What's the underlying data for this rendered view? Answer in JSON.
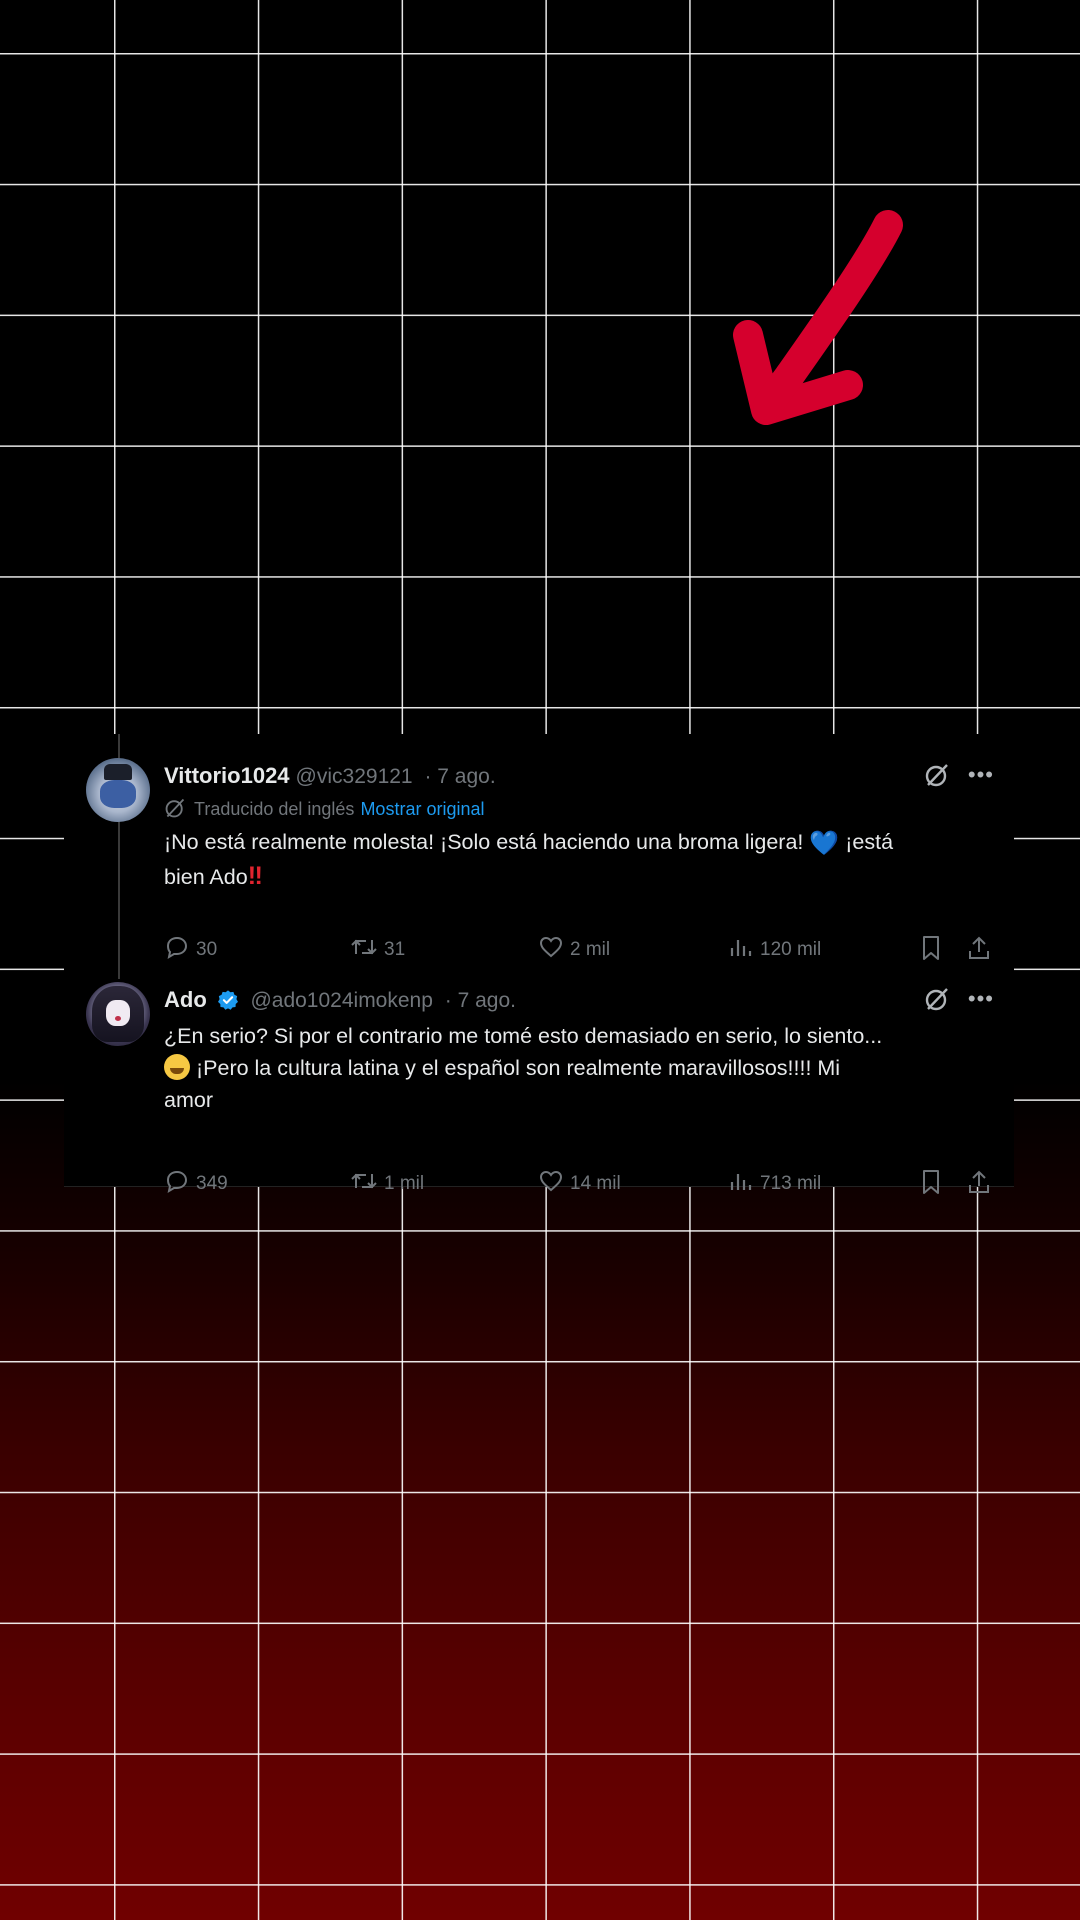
{
  "colors": {
    "accent": "#1d9bf0",
    "annotation_arrow": "#d5002d",
    "background_bottom": "#700000"
  },
  "tweets": [
    {
      "name": "Vittorio1024",
      "handle": "@vic329121",
      "meta": "· 7 ago.",
      "translated_label": "Traducido del inglés",
      "show_original": "Mostrar original",
      "text_line1": "¡No está realmente molesta! ¡Solo está haciendo una broma ligera!",
      "emoji_heart": "💙",
      "text_line1b": "¡está",
      "text_line2": "bien Ado",
      "text_bang": "‼",
      "replies": "30",
      "retweets": "31",
      "likes": "2 mil",
      "views": "120 mil"
    },
    {
      "name": "Ado",
      "verified": true,
      "handle": "@ado1024imokenp",
      "meta": "· 7 ago.",
      "text_line1": "¿En serio? Si por el contrario me tomé esto demasiado en serio, lo siento...",
      "text_line2": "¡Pero la cultura latina y el español son realmente maravillosos!!!! Mi",
      "text_line3": "amor",
      "replies": "349",
      "retweets": "1 mil",
      "likes": "14 mil",
      "views": "713 mil"
    }
  ]
}
